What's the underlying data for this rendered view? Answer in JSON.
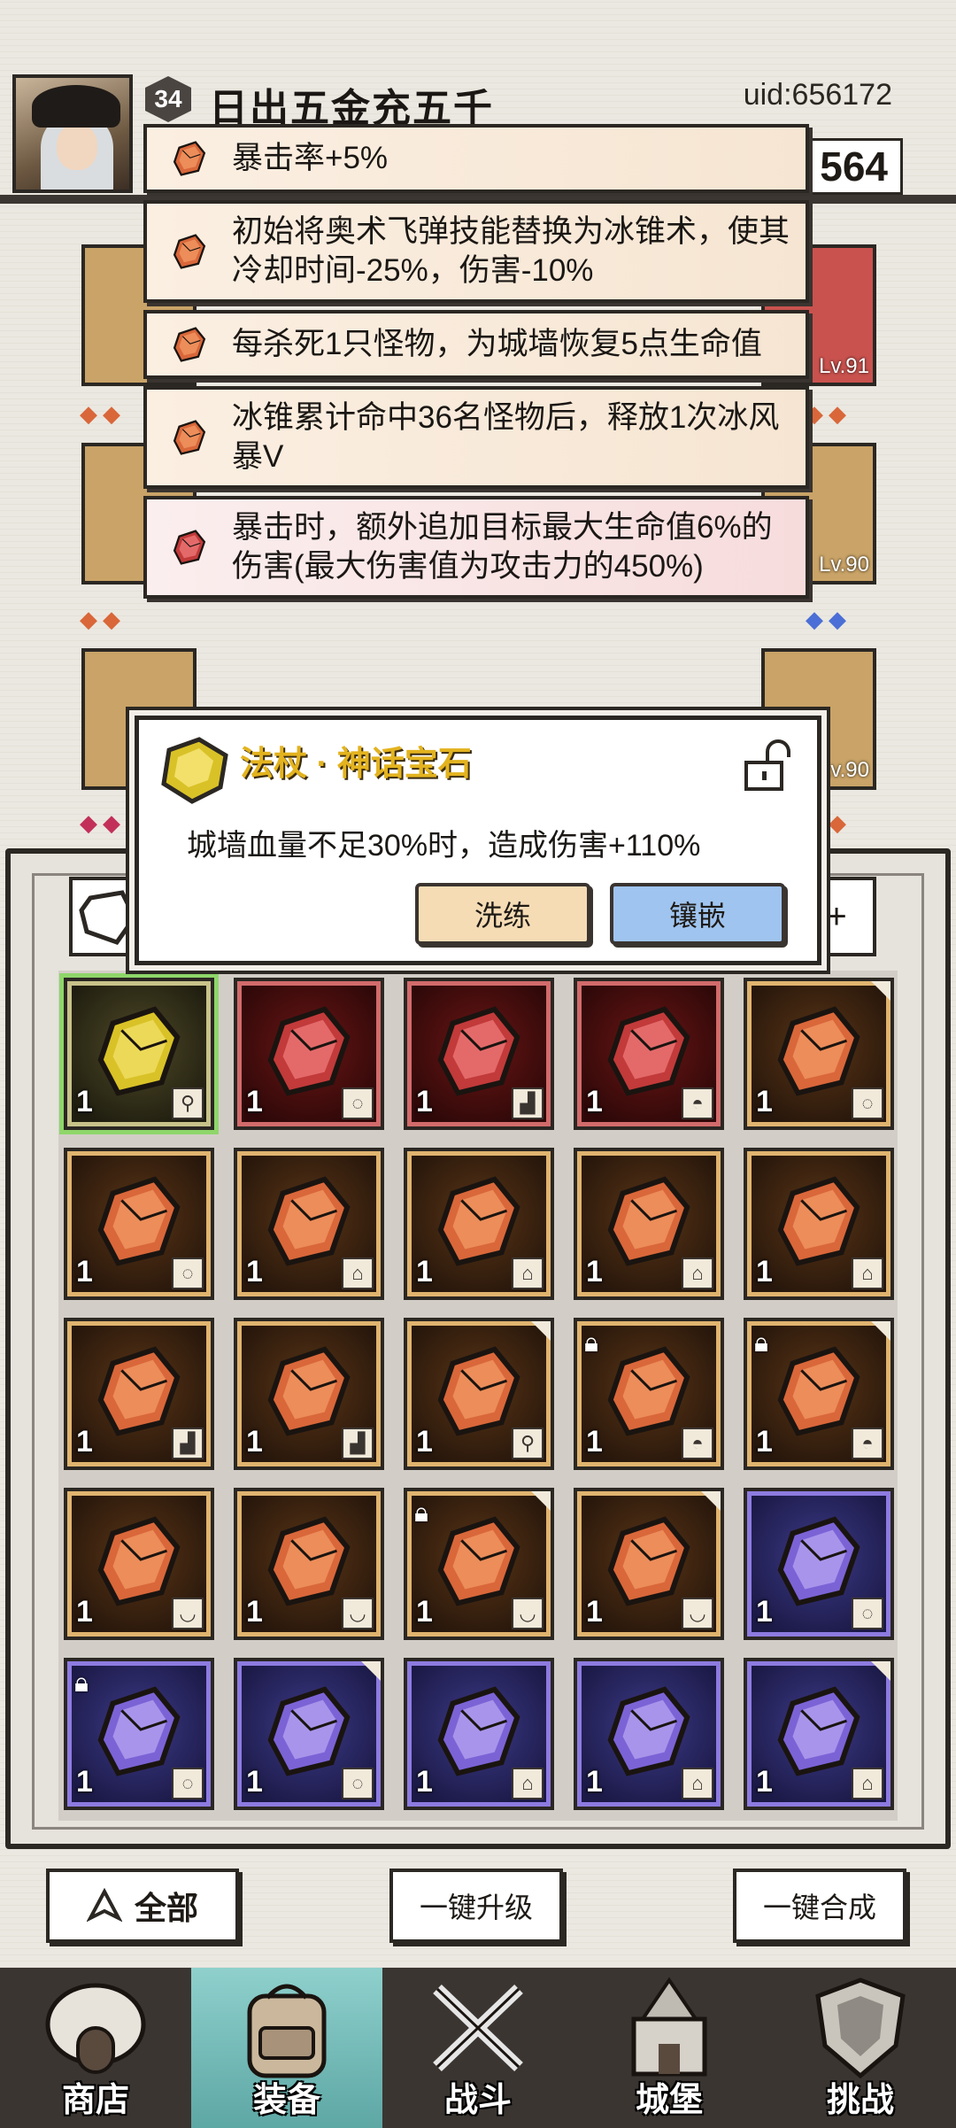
{
  "player": {
    "level": "34",
    "name": "日出五金充五千",
    "uid": "uid:656172",
    "currency": "564"
  },
  "equip_levels": [
    "Lv.91",
    "Lv.90",
    "Lv.90"
  ],
  "effects": [
    {
      "text": "暴击率+5%",
      "gem": "orange"
    },
    {
      "text": "初始将奥术飞弹技能替换为冰锥术，使其冷却时间-25%，伤害-10%",
      "gem": "orange"
    },
    {
      "text": "每杀死1只怪物，为城墙恢复5点生命值",
      "gem": "orange"
    },
    {
      "text": "冰锥累计命中36名怪物后，释放1次冰风暴V",
      "gem": "orange"
    },
    {
      "text": "暴击时，额外追加目标最大生命值6%的伤害(最大伤害值为攻击力的450%)",
      "gem": "red"
    }
  ],
  "popup": {
    "title": "法杖 · 神话宝石",
    "description": "城墙血量不足30%时，造成伤害+110%",
    "wash_label": "洗练",
    "inlay_label": "镶嵌"
  },
  "inventory": [
    {
      "color": "gold",
      "count": "1",
      "slot": "staff-icon",
      "lock": false,
      "corner": false
    },
    {
      "color": "red",
      "count": "1",
      "slot": "ring-icon",
      "lock": false,
      "corner": false
    },
    {
      "color": "red",
      "count": "1",
      "slot": "boot-icon",
      "lock": false,
      "corner": false
    },
    {
      "color": "red",
      "count": "1",
      "slot": "hat-icon",
      "lock": false,
      "corner": false
    },
    {
      "color": "orange",
      "count": "1",
      "slot": "ring-icon",
      "lock": false,
      "corner": true
    },
    {
      "color": "orange",
      "count": "1",
      "slot": "ring-icon",
      "lock": false,
      "corner": false
    },
    {
      "color": "orange",
      "count": "1",
      "slot": "armor-icon",
      "lock": false,
      "corner": false
    },
    {
      "color": "orange",
      "count": "1",
      "slot": "armor-icon",
      "lock": false,
      "corner": false
    },
    {
      "color": "orange",
      "count": "1",
      "slot": "armor-icon",
      "lock": false,
      "corner": false
    },
    {
      "color": "orange",
      "count": "1",
      "slot": "armor-icon",
      "lock": false,
      "corner": false
    },
    {
      "color": "orange",
      "count": "1",
      "slot": "boot-icon",
      "lock": false,
      "corner": false
    },
    {
      "color": "orange",
      "count": "1",
      "slot": "boot-icon",
      "lock": false,
      "corner": false
    },
    {
      "color": "orange",
      "count": "1",
      "slot": "staff-icon",
      "lock": false,
      "corner": true
    },
    {
      "color": "orange",
      "count": "1",
      "slot": "hat-icon",
      "lock": true,
      "corner": false
    },
    {
      "color": "orange",
      "count": "1",
      "slot": "hat-icon",
      "lock": true,
      "corner": true
    },
    {
      "color": "orange",
      "count": "1",
      "slot": "necklace-icon",
      "lock": false,
      "corner": false
    },
    {
      "color": "orange",
      "count": "1",
      "slot": "necklace-icon",
      "lock": false,
      "corner": false
    },
    {
      "color": "orange",
      "count": "1",
      "slot": "necklace-icon",
      "lock": true,
      "corner": true
    },
    {
      "color": "orange",
      "count": "1",
      "slot": "necklace-icon",
      "lock": false,
      "corner": true
    },
    {
      "color": "purple",
      "count": "1",
      "slot": "ring-icon",
      "lock": false,
      "corner": false
    },
    {
      "color": "purple",
      "count": "1",
      "slot": "ring-icon",
      "lock": true,
      "corner": false
    },
    {
      "color": "purple",
      "count": "1",
      "slot": "ring-icon",
      "lock": false,
      "corner": true
    },
    {
      "color": "purple",
      "count": "1",
      "slot": "armor-icon",
      "lock": false,
      "corner": false
    },
    {
      "color": "purple",
      "count": "1",
      "slot": "armor-icon",
      "lock": false,
      "corner": false
    },
    {
      "color": "purple",
      "count": "1",
      "slot": "armor-icon",
      "lock": false,
      "corner": true
    }
  ],
  "actions": {
    "filter_label": "全部",
    "upgrade_label": "一键升级",
    "merge_label": "一键合成"
  },
  "nav": [
    {
      "label": "商店",
      "icon": "shop-icon",
      "active": false
    },
    {
      "label": "装备",
      "icon": "backpack-icon",
      "active": true
    },
    {
      "label": "战斗",
      "icon": "swords-icon",
      "active": false
    },
    {
      "label": "城堡",
      "icon": "castle-icon",
      "active": false
    },
    {
      "label": "挑战",
      "icon": "shield-icon",
      "active": false
    }
  ],
  "colors": {
    "orange_gem": "#d9673a",
    "red_gem": "#c23a3a",
    "purple_gem": "#7b63d6",
    "gold_gem": "#d9c227",
    "popup_title": "#e3b31f",
    "nav_active": "#8fd0cc"
  }
}
